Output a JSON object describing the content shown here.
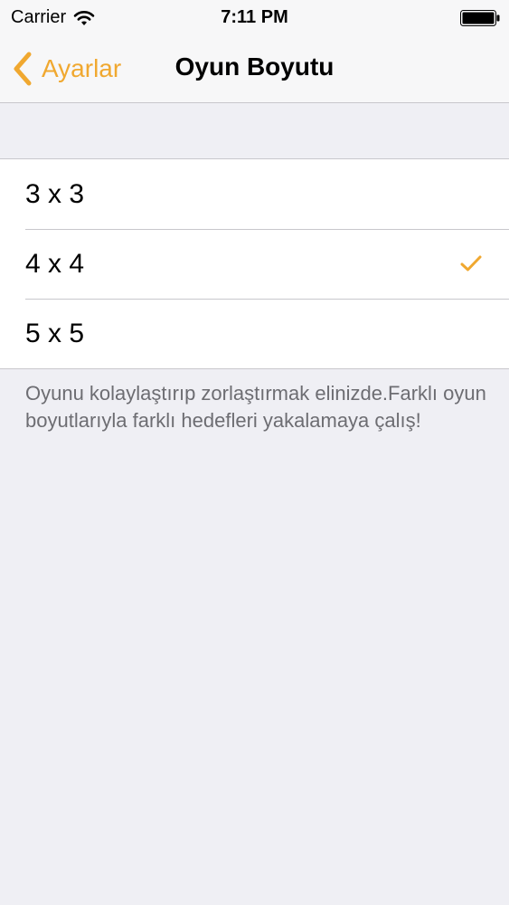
{
  "status_bar": {
    "carrier": "Carrier",
    "time": "7:11 PM"
  },
  "nav": {
    "back_label": "Ayarlar",
    "title": "Oyun Boyutu"
  },
  "options": [
    {
      "label": "3 x 3",
      "selected": false
    },
    {
      "label": "4 x 4",
      "selected": true
    },
    {
      "label": "5 x 5",
      "selected": false
    }
  ],
  "footer_note": "Oyunu kolaylaştırıp zorlaştırmak elinizde.Farklı oyun boyutlarıyla farklı hedefleri yakalamaya çalış!",
  "colors": {
    "accent": "#f0a830",
    "background": "#efeff4",
    "separator": "#c8c7cc"
  },
  "icons": {
    "signal": "wifi-icon",
    "battery": "battery-icon",
    "back": "chevron-left-icon",
    "selected": "checkmark-icon"
  }
}
